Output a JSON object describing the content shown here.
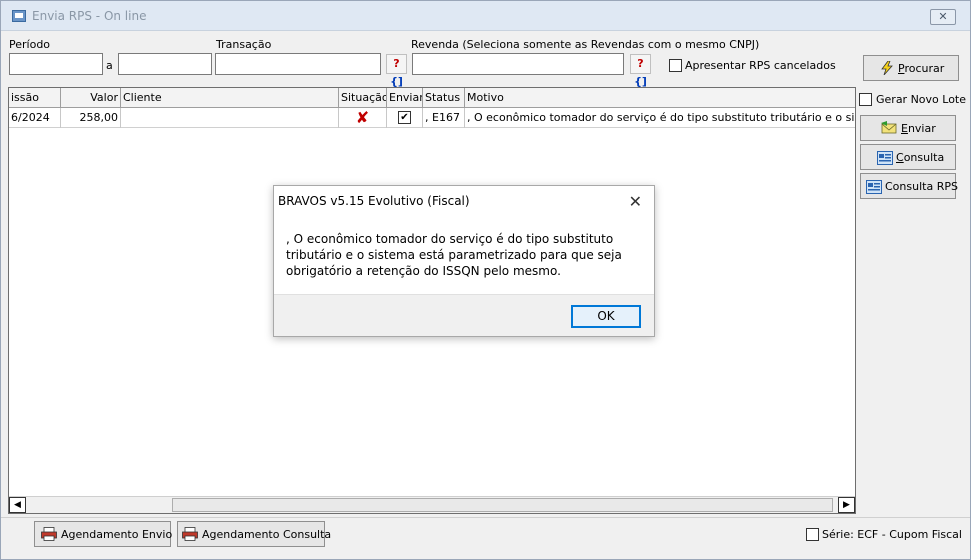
{
  "window": {
    "title": "Envia RPS - On line",
    "close": "✕"
  },
  "filters": {
    "periodo_label": "Período",
    "a_label": "a",
    "transacao_label": "Transação",
    "revenda_label": "Revenda (Seleciona somente as Revendas com o mesmo CNPJ)",
    "periodo_inicio": "",
    "periodo_fim": "",
    "transacao_value": "",
    "revenda_value": "",
    "lookup_q": "?",
    "lookup_b": "{]",
    "cancelados_label": "Apresentar RPS cancelados"
  },
  "buttons": {
    "procurar_u": "P",
    "procurar_rest": "rocurar",
    "gerar_lote": "Gerar Novo Lote",
    "enviar_u": "E",
    "enviar_rest": "nviar",
    "consulta_u": "C",
    "consulta_rest": "onsulta",
    "consulta_rps": "Consulta RPS",
    "agendamento_envio": "Agendamento Envio",
    "agendamento_consulta": "Agendamento Consulta",
    "serie": "Série: ECF - Cupom Fiscal"
  },
  "grid": {
    "columns": [
      "issão",
      "Valor",
      "Cliente",
      "Situação",
      "Enviar",
      "Status",
      "Motivo"
    ],
    "rows": [
      {
        "emissao": "6/2024",
        "valor": "258,00",
        "cliente": "",
        "situacao": "✘",
        "enviar": "✔",
        "status": ", E167",
        "motivo": ", O econômico tomador do serviço é do tipo substituto tributário e o sistema"
      }
    ]
  },
  "dialog": {
    "title": "BRAVOS v5.15 Evolutivo (Fiscal)",
    "close": "✕",
    "message": ", O econômico tomador do serviço é do tipo substituto\ntributário e o sistema está parametrizado para que seja\nobrigatório a retenção do ISSQN pelo mesmo.",
    "ok": "OK"
  },
  "colors": {
    "accent": "#0078d7",
    "error_red": "#c00000",
    "lookup_blue": "#003bb8"
  },
  "icons": [
    "window-icon",
    "close-icon",
    "lightning-icon",
    "send-icon",
    "query-icon",
    "printer-icon",
    "checkbox-icon",
    "arrow-left-icon",
    "arrow-right-icon"
  ]
}
